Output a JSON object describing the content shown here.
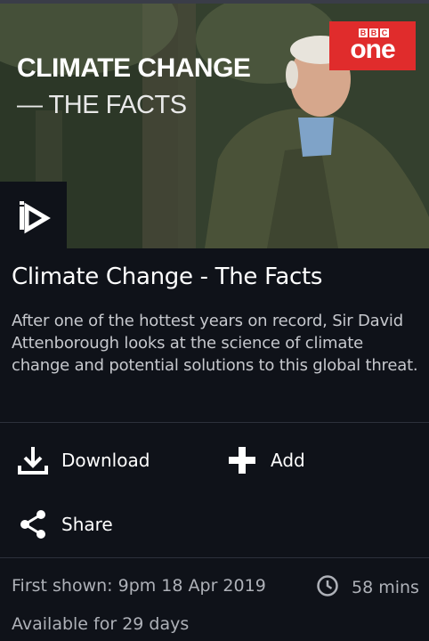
{
  "hero": {
    "title_line1": "CLIMATE CHANGE",
    "title_line2": "— THE FACTS",
    "channel": {
      "bbc_letters": [
        "B",
        "B",
        "C"
      ],
      "name": "one",
      "color": "#e02c2c"
    },
    "player_logo_icon": "iplayer-logo-icon"
  },
  "programme": {
    "title": "Climate Change - The Facts",
    "description": "After one of the hottest years on record, Sir David Attenborough looks at the science of climate change and potential solutions to this global threat."
  },
  "actions": {
    "download": {
      "label": "Download",
      "icon": "download-icon"
    },
    "add": {
      "label": "Add",
      "icon": "plus-icon"
    },
    "share": {
      "label": "Share",
      "icon": "share-icon"
    }
  },
  "meta": {
    "first_shown": "First shown: 9pm 18 Apr 2019",
    "duration": "58 mins",
    "duration_icon": "clock-icon",
    "availability": "Available for 29 days"
  },
  "colors": {
    "background": "#0f1219",
    "text_primary": "#ffffff",
    "text_secondary": "#aeb1b8"
  }
}
